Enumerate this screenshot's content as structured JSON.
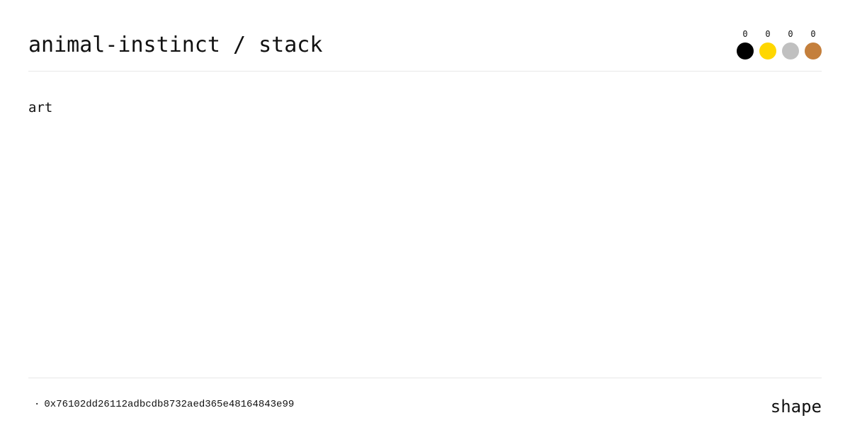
{
  "header": {
    "title": "animal-instinct / stack",
    "badges": [
      {
        "name": "black",
        "count": "0",
        "color": "#000000"
      },
      {
        "name": "gold",
        "count": "0",
        "color": "#FFD700"
      },
      {
        "name": "silver",
        "count": "0",
        "color": "#C0C0C0"
      },
      {
        "name": "bronze",
        "count": "0",
        "color": "#C47F3C"
      }
    ]
  },
  "main": {
    "tag": "art"
  },
  "footer": {
    "separator": "·",
    "address": "0x76102dd26112adbcdb8732aed365e48164843e99",
    "brand": "shape"
  }
}
